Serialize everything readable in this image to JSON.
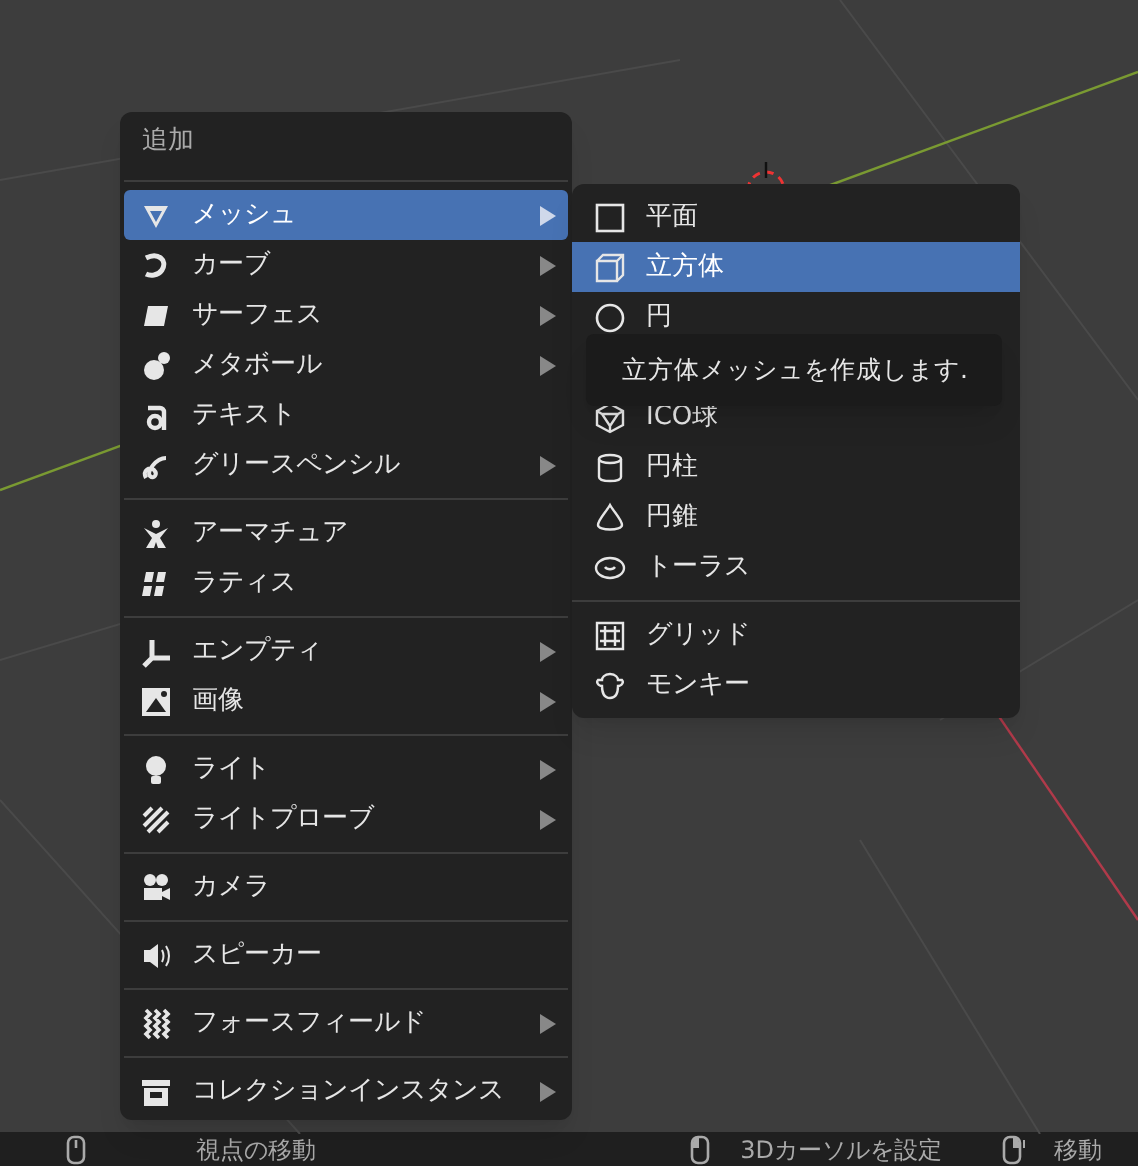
{
  "menu": {
    "title": "追加",
    "groups": [
      [
        {
          "label": "メッシュ",
          "submenu": true,
          "selected": true
        },
        {
          "label": "カーブ",
          "submenu": true,
          "selected": false
        },
        {
          "label": "サーフェス",
          "submenu": true,
          "selected": false
        },
        {
          "label": "メタボール",
          "submenu": true,
          "selected": false
        },
        {
          "label": "テキスト",
          "submenu": false,
          "selected": false
        },
        {
          "label": "グリースペンシル",
          "submenu": true,
          "selected": false
        }
      ],
      [
        {
          "label": "アーマチュア",
          "submenu": false,
          "selected": false
        },
        {
          "label": "ラティス",
          "submenu": false,
          "selected": false
        }
      ],
      [
        {
          "label": "エンプティ",
          "submenu": true,
          "selected": false
        },
        {
          "label": "画像",
          "submenu": true,
          "selected": false
        }
      ],
      [
        {
          "label": "ライト",
          "submenu": true,
          "selected": false
        },
        {
          "label": "ライトプローブ",
          "submenu": true,
          "selected": false
        }
      ],
      [
        {
          "label": "カメラ",
          "submenu": false,
          "selected": false
        }
      ],
      [
        {
          "label": "スピーカー",
          "submenu": false,
          "selected": false
        }
      ],
      [
        {
          "label": "フォースフィールド",
          "submenu": true,
          "selected": false
        }
      ],
      [
        {
          "label": "コレクションインスタンス",
          "submenu": true,
          "selected": false
        }
      ]
    ]
  },
  "submenu": {
    "groups": [
      [
        {
          "label": "平面",
          "selected": false
        },
        {
          "label": "立方体",
          "selected": true
        },
        {
          "label": "円",
          "selected": false
        },
        {
          "label": "ICO球",
          "selected": false
        },
        {
          "label": "円柱",
          "selected": false
        },
        {
          "label": "円錐",
          "selected": false
        },
        {
          "label": "トーラス",
          "selected": false
        }
      ],
      [
        {
          "label": "グリッド",
          "selected": false
        },
        {
          "label": "モンキー",
          "selected": false
        }
      ]
    ]
  },
  "tooltip": {
    "text": "立方体メッシュを作成します."
  },
  "status_bar": {
    "left": [
      {
        "label": "視点の移動"
      }
    ],
    "right": [
      {
        "label": "3Dカーソルを設定"
      },
      {
        "label": "移動"
      }
    ]
  }
}
